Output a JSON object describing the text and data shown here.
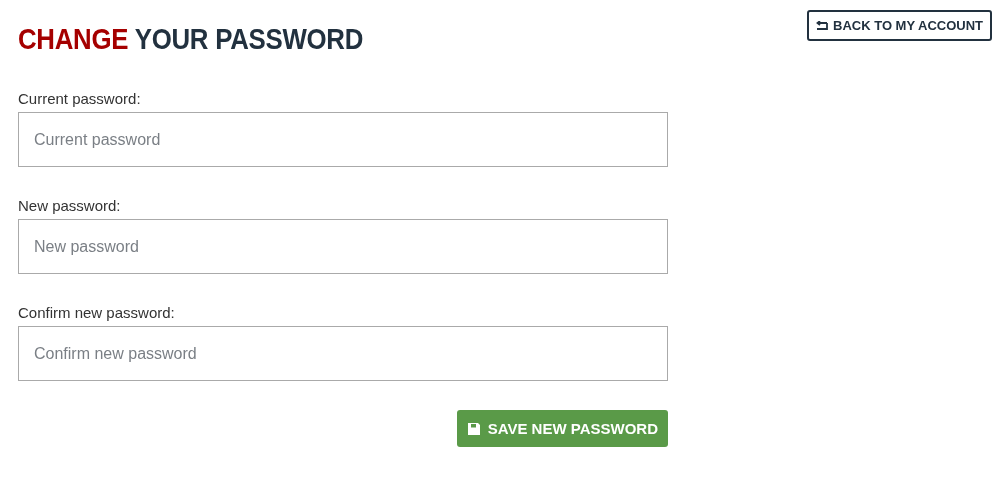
{
  "title": {
    "accent": "CHANGE",
    "rest": "YOUR PASSWORD"
  },
  "back_button": {
    "label": "BACK TO MY ACCOUNT"
  },
  "fields": [
    {
      "label": "Current password:",
      "placeholder": "Current password"
    },
    {
      "label": "New password:",
      "placeholder": "New password"
    },
    {
      "label": "Confirm new password:",
      "placeholder": "Confirm new password"
    }
  ],
  "save_button": {
    "label": "SAVE NEW PASSWORD"
  }
}
